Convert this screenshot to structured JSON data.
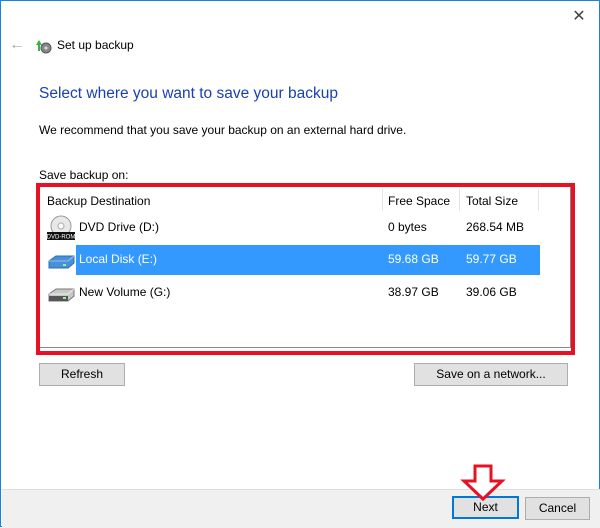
{
  "window": {
    "title": "Set up backup",
    "close_icon": "close-icon",
    "back_icon": "back-arrow-icon"
  },
  "main": {
    "heading": "Select where you want to save your backup",
    "recommendation": "We recommend that you save your backup on an external hard drive.",
    "save_label": "Save backup on:"
  },
  "table": {
    "columns": [
      "Backup Destination",
      "Free Space",
      "Total Size"
    ],
    "rows": [
      {
        "name": "DVD Drive (D:)",
        "free": "0 bytes",
        "total": "268.54 MB",
        "icon": "dvd-drive-icon",
        "icon_label": "DVD-ROM",
        "selected": false
      },
      {
        "name": "Local Disk (E:)",
        "free": "59.68 GB",
        "total": "59.77 GB",
        "icon": "hard-disk-icon",
        "selected": true
      },
      {
        "name": "New Volume (G:)",
        "free": "38.97 GB",
        "total": "39.06 GB",
        "icon": "hard-disk-icon",
        "selected": false
      }
    ]
  },
  "buttons": {
    "refresh": "Refresh",
    "save_network": "Save on a network...",
    "next": "Next",
    "cancel": "Cancel"
  },
  "colors": {
    "accent": "#0078d7",
    "selection": "#3399ff",
    "annotation": "#e81123",
    "heading": "#1a3fb0"
  }
}
